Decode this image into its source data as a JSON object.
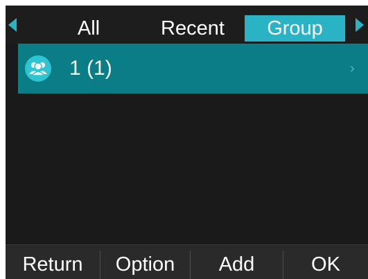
{
  "tabs": {
    "all": "All",
    "recent": "Recent",
    "group": "Group",
    "selected": "Group"
  },
  "list": {
    "items": [
      {
        "label": "1 (1)",
        "icon": "group-icon"
      }
    ],
    "chevron": "›"
  },
  "softkeys": {
    "return": "Return",
    "option": "Option",
    "add": "Add",
    "ok": "OK"
  },
  "colors": {
    "accent": "#2ab3c4",
    "selected_row": "#0b7d86",
    "background": "#1a1a1a"
  }
}
